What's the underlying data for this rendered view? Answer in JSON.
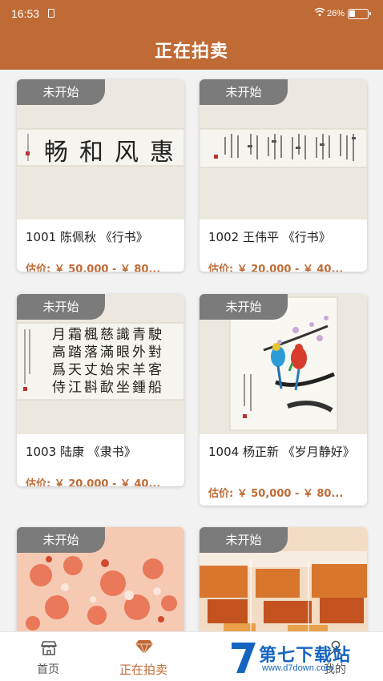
{
  "status": {
    "time": "16:53",
    "battery": "26%"
  },
  "header": {
    "title": "正在拍卖"
  },
  "lots": [
    {
      "badge": "未开始",
      "title": "1001 陈佩秋 《行书》",
      "price": "估价: ￥ 50,000 - ￥ 80..."
    },
    {
      "badge": "未开始",
      "title": "1002 王伟平 《行书》",
      "price": "估价: ￥ 20,000 - ￥ 40..."
    },
    {
      "badge": "未开始",
      "title": "1003 陆康 《隶书》",
      "price": "估价: ￥ 20,000 - ￥ 40..."
    },
    {
      "badge": "未开始",
      "title": "1004 杨正新 《岁月静好》",
      "price": "估价: ￥ 50,000 - ￥ 80..."
    },
    {
      "badge": "未开始"
    },
    {
      "badge": "未开始"
    }
  ],
  "artwork": {
    "lot1": "惠风和畅",
    "lot3_lines": [
      "月霜楓慈識青駛",
      "高踏落滿眼外對",
      "爲天丈始宋羊客",
      "侍江斟歃坐鍾船"
    ]
  },
  "tabbar": {
    "items": [
      {
        "label": "首页",
        "icon": "shop-icon"
      },
      {
        "label": "正在拍卖",
        "icon": "gem-icon",
        "active": true
      },
      {
        "label": "我的",
        "icon": "user-icon"
      }
    ]
  },
  "watermark": {
    "text": "第七下载站",
    "url": "www.d7down.com"
  }
}
